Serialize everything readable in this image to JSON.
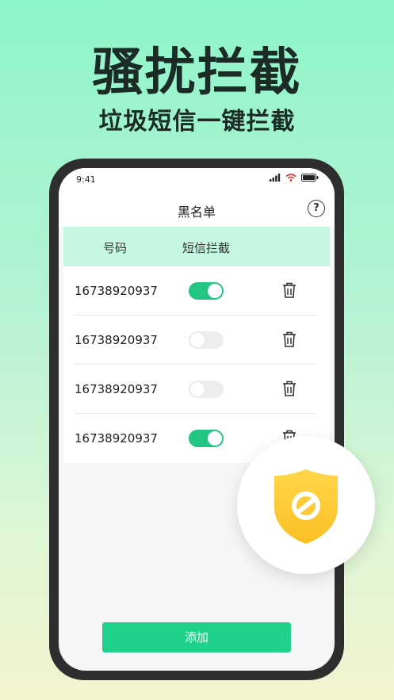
{
  "hero": {
    "title": "骚扰拦截",
    "subtitle": "垃圾短信一键拦截"
  },
  "status_bar": {
    "time": "9:41",
    "icons": [
      "signal-icon",
      "wifi-icon",
      "battery-icon"
    ]
  },
  "header": {
    "title": "黑名单",
    "help_label": "?"
  },
  "table": {
    "columns": [
      "号码",
      "短信拦截"
    ],
    "rows": [
      {
        "number": "16738920937",
        "sms_block": true
      },
      {
        "number": "16738920937",
        "sms_block": false
      },
      {
        "number": "16738920937",
        "sms_block": false
      },
      {
        "number": "16738920937",
        "sms_block": true
      }
    ]
  },
  "actions": {
    "add_label": "添加"
  },
  "colors": {
    "accent": "#1fd18b",
    "toggle_on": "#23c583",
    "header_bg": "#c5f7e3",
    "shield": "#fdc92f"
  }
}
